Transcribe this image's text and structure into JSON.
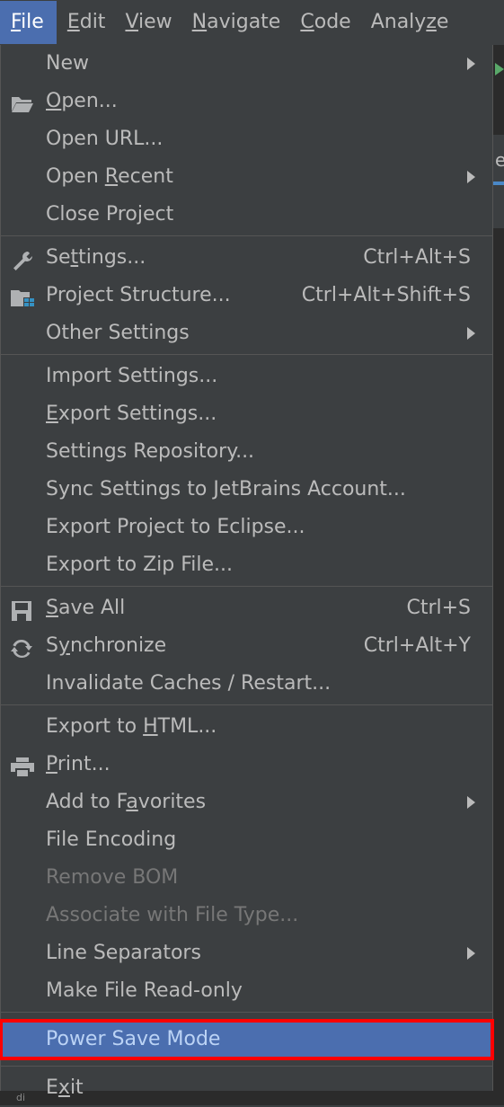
{
  "menubar": {
    "items": [
      "File",
      "Edit",
      "View",
      "Navigate",
      "Code",
      "Analyze"
    ],
    "active": "File",
    "mnemonics": [
      "F",
      "E",
      "V",
      "N",
      "C",
      "z"
    ]
  },
  "menu": {
    "sections": [
      {
        "items": [
          {
            "label": "New",
            "submenu": true
          },
          {
            "label": "Open...",
            "icon": "folder-open-icon",
            "underline": "O"
          },
          {
            "label": "Open URL..."
          },
          {
            "label": "Open Recent",
            "submenu": true,
            "underline": "R"
          },
          {
            "label": "Close Project",
            "underline": "j"
          }
        ]
      },
      {
        "items": [
          {
            "label": "Settings...",
            "icon": "wrench-icon",
            "shortcut": "Ctrl+Alt+S",
            "underline": "t"
          },
          {
            "label": "Project Structure...",
            "icon": "project-structure-icon",
            "shortcut": "Ctrl+Alt+Shift+S"
          },
          {
            "label": "Other Settings",
            "submenu": true
          }
        ]
      },
      {
        "items": [
          {
            "label": "Import Settings..."
          },
          {
            "label": "Export Settings...",
            "underline": "E"
          },
          {
            "label": "Settings Repository..."
          },
          {
            "label": "Sync Settings to JetBrains Account..."
          },
          {
            "label": "Export Project to Eclipse..."
          },
          {
            "label": "Export to Zip File..."
          }
        ]
      },
      {
        "items": [
          {
            "label": "Save All",
            "icon": "save-icon",
            "shortcut": "Ctrl+S",
            "underline": "S"
          },
          {
            "label": "Synchronize",
            "icon": "sync-icon",
            "shortcut": "Ctrl+Alt+Y",
            "underline": "y"
          },
          {
            "label": "Invalidate Caches / Restart..."
          }
        ]
      },
      {
        "items": [
          {
            "label": "Export to HTML...",
            "underline": "H"
          },
          {
            "label": "Print...",
            "icon": "printer-icon",
            "underline": "P"
          },
          {
            "label": "Add to Favorites",
            "submenu": true,
            "underline": "a"
          },
          {
            "label": "File Encoding"
          },
          {
            "label": "Remove BOM",
            "disabled": true
          },
          {
            "label": "Associate with File Type...",
            "disabled": true
          },
          {
            "label": "Line Separators",
            "submenu": true
          },
          {
            "label": "Make File Read-only"
          }
        ]
      },
      {
        "items": [
          {
            "label": "Power Save Mode",
            "selected": true
          }
        ]
      },
      {
        "items": [
          {
            "label": "Exit",
            "underline": "x"
          }
        ]
      }
    ]
  },
  "colors": {
    "menu_bg": "#3c3f41",
    "selection": "#4b6eaf",
    "text": "#bbbbbb",
    "disabled_text": "#777777",
    "highlight_box": "#ff0000"
  },
  "background": {
    "tab_fragment": "e",
    "bottom_fragment": "di"
  }
}
